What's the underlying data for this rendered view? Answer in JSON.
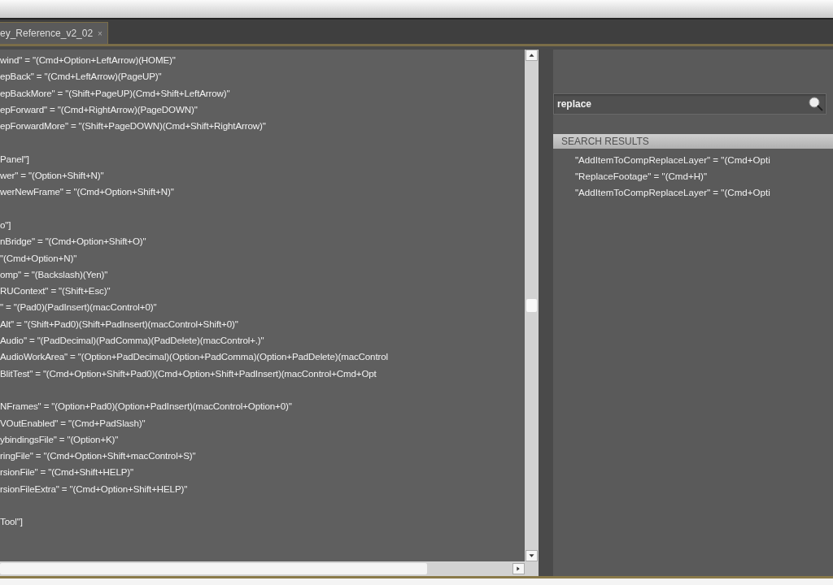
{
  "tab": {
    "label": "ey_Reference_v2_02",
    "close": "×",
    "selected": true
  },
  "editor": {
    "blocks": [
      {
        "lines": [
          "wind\" = \"(Cmd+Option+LeftArrow)(HOME)\"",
          "epBack\" = \"(Cmd+LeftArrow)(PageUP)\"",
          "epBackMore\" = \"(Shift+PageUP)(Cmd+Shift+LeftArrow)\"",
          "epForward\" = \"(Cmd+RightArrow)(PageDOWN)\"",
          "epForwardMore\" = \"(Shift+PageDOWN)(Cmd+Shift+RightArrow)\""
        ]
      },
      {
        "lines": [
          "Panel\"]",
          "wer\" = \"(Option+Shift+N)\"",
          "werNewFrame\" = \"(Cmd+Option+Shift+N)\""
        ]
      },
      {
        "lines": [
          "o\"]",
          "nBridge\" = \"(Cmd+Option+Shift+O)\"",
          "\"(Cmd+Option+N)\"",
          "omp\" = \"(Backslash)(Yen)\"",
          "RUContext\" = \"(Shift+Esc)\"",
          "\" = \"(Pad0)(PadInsert)(macControl+0)\"",
          "Alt\" = \"(Shift+Pad0)(Shift+PadInsert)(macControl+Shift+0)\"",
          "Audio\" = \"(PadDecimal)(PadComma)(PadDelete)(macControl+.)\"",
          "AudioWorkArea\" = \"(Option+PadDecimal)(Option+PadComma)(Option+PadDelete)(macControl",
          "BlitTest\" = \"(Cmd+Option+Shift+Pad0)(Cmd+Option+Shift+PadInsert)(macControl+Cmd+Opt"
        ]
      },
      {
        "lines": [
          "NFrames\" = \"(Option+Pad0)(Option+PadInsert)(macControl+Option+0)\"",
          "VOutEnabled\" = \"(Cmd+PadSlash)\"",
          "ybindingsFile\" = \"(Option+K)\"",
          "ringFile\" = \"(Cmd+Option+Shift+macControl+S)\"",
          "rsionFile\" = \"(Cmd+Shift+HELP)\"",
          "rsionFileExtra\" = \"(Cmd+Option+Shift+HELP)\""
        ]
      },
      {
        "lines": [
          "Tool\"]"
        ]
      }
    ]
  },
  "search": {
    "value": "replace",
    "results_title": "SEARCH RESULTS",
    "results": [
      "\"AddItemToCompReplaceLayer\" = \"(Cmd+Opti",
      "\"ReplaceFootage\" = \"(Cmd+H)\"",
      "\"AddItemToCompReplaceLayer\" = \"(Cmd+Opti"
    ]
  }
}
